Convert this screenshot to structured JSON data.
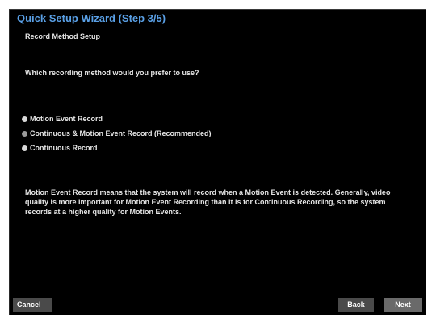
{
  "wizard": {
    "title": "Quick Setup Wizard (Step 3/5)",
    "subtitle": "Record Method Setup",
    "question": "Which recording method would you prefer to use?"
  },
  "options": [
    {
      "label": "Motion Event Record",
      "selected": false
    },
    {
      "label": "Continuous & Motion Event Record (Recommended)",
      "selected": true
    },
    {
      "label": "Continuous Record",
      "selected": false
    }
  ],
  "description": "Motion Event Record means that the system will record when a Motion Event is detected. Generally, video quality is more important for Motion Event Recording than it is for Continuous Recording, so the system records at a higher quality for Motion Events.",
  "buttons": {
    "cancel": "Cancel",
    "back": "Back",
    "next": "Next"
  },
  "colors": {
    "title": "#5aa0e6",
    "background": "#000000",
    "button": "#4a4a4a",
    "button_primary": "#6a6a6a"
  }
}
